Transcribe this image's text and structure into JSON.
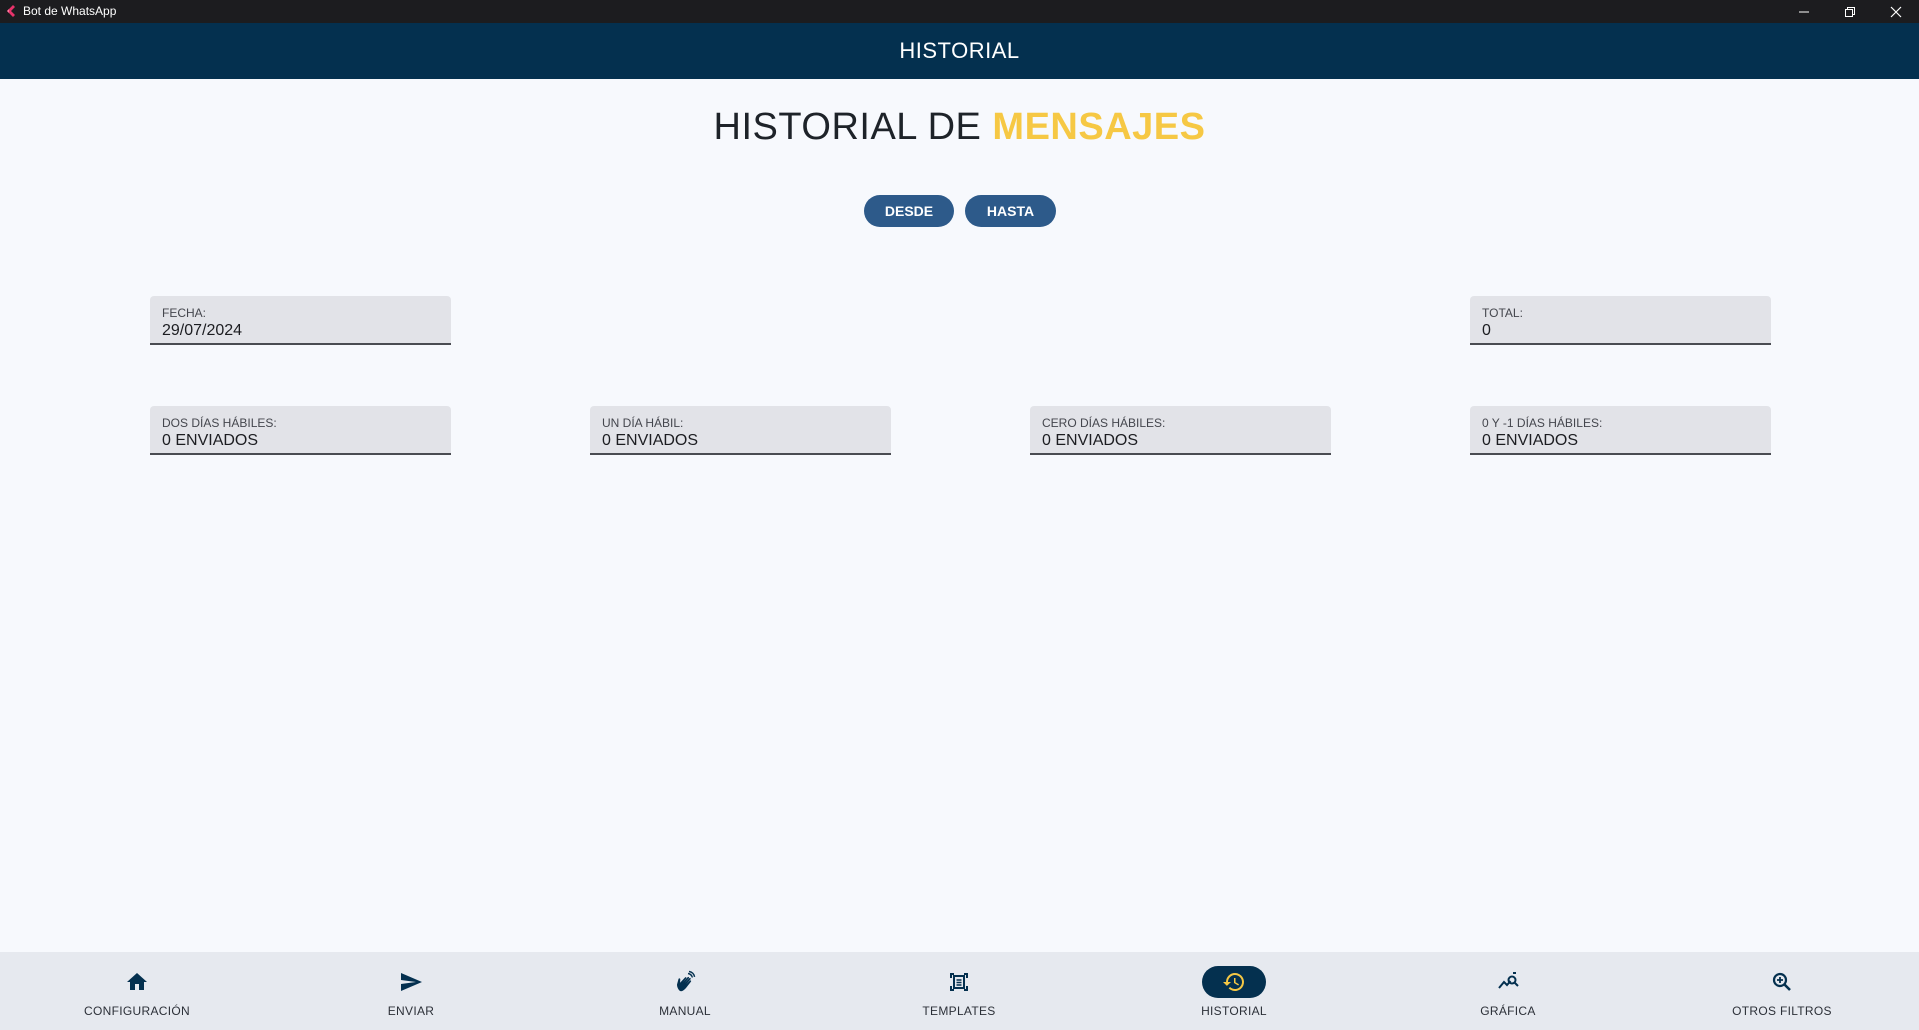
{
  "window": {
    "title": "Bot de WhatsApp"
  },
  "appbar": {
    "title": "HISTORIAL"
  },
  "heading": {
    "prefix": "HISTORIAL DE ",
    "accent": "MENSAJES"
  },
  "buttons": {
    "desde": "DESDE",
    "hasta": "HASTA"
  },
  "fields": {
    "fecha": {
      "label": "FECHA:",
      "value": "29/07/2024"
    },
    "total": {
      "label": "TOTAL:",
      "value": "0"
    },
    "dos_dias": {
      "label": "DOS DÍAS HÁBILES:",
      "value": "0 ENVIADOS"
    },
    "un_dia": {
      "label": "UN DÍA HÁBIL:",
      "value": "0 ENVIADOS"
    },
    "cero_dias": {
      "label": "CERO DÍAS HÁBILES:",
      "value": "0 ENVIADOS"
    },
    "cero_menos_uno": {
      "label": "0 Y -1 DÍAS HÁBILES:",
      "value": "0 ENVIADOS"
    }
  },
  "nav": {
    "items": [
      {
        "label": "CONFIGURACIÓN",
        "icon": "home-icon",
        "active": false
      },
      {
        "label": "ENVIAR",
        "icon": "send-icon",
        "active": false
      },
      {
        "label": "MANUAL",
        "icon": "hand-wave-icon",
        "active": false
      },
      {
        "label": "TEMPLATES",
        "icon": "document-scan-icon",
        "active": false
      },
      {
        "label": "HISTORIAL",
        "icon": "history-icon",
        "active": true
      },
      {
        "label": "GRÁFICA",
        "icon": "query-stats-icon",
        "active": false
      },
      {
        "label": "OTROS FILTROS",
        "icon": "zoom-in-icon",
        "active": false
      }
    ]
  },
  "colors": {
    "header": "#04304f",
    "accent": "#f6c844",
    "button": "#2d5a8a",
    "background": "#f7f9fd",
    "nav_background": "#e6e9ef"
  }
}
